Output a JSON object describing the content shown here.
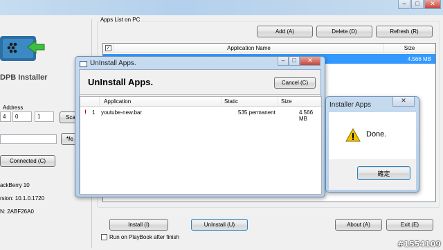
{
  "main_window": {
    "app_title": "DPB Installer",
    "address_label": "Address",
    "ip_octets": [
      "4",
      "0",
      "1"
    ],
    "scan_label": "Sca",
    "browse_label": "*/c",
    "connected_label": "Connected (C)",
    "device_info": [
      "ackBerry 10",
      "rsion: 10.1.0.1720",
      "N: 2ABF26A0"
    ],
    "apps_group_label": "Apps List on PC",
    "add_label": "Add (A)",
    "delete_label": "Delete (D)",
    "refresh_label": "Refresh (R)",
    "columns": [
      "Application Name",
      "Size"
    ],
    "rows": [
      {
        "size": "4.566 MB"
      }
    ],
    "install_label": "Install (I)",
    "uninstall_label": "UnInstall (U)",
    "about_label": "About (A)",
    "exit_label": "Exit (E)",
    "run_after_label": "Run on PlayBook after finish"
  },
  "uninstall_dialog": {
    "title": "UnInstall Apps.",
    "heading": "UnInstall Apps.",
    "cancel_label": "Cancel (C)",
    "columns": [
      "Application",
      "Static",
      "Size"
    ],
    "rows": [
      {
        "index": "1",
        "application": "youtube-new.bar",
        "static": "535 permanent",
        "size": "4.566 MB"
      }
    ]
  },
  "installer_dialog": {
    "title": "Installer Apps",
    "message": "Done.",
    "ok_label": "確定"
  },
  "watermark": "#1554109",
  "colors": {
    "selection": "#3399ff",
    "titlebar": "#b9d3ec",
    "warning": "#f2c200"
  }
}
